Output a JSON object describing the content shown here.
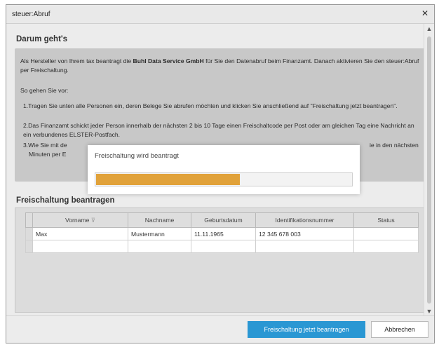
{
  "window": {
    "title": "steuer:Abruf"
  },
  "info": {
    "heading": "Darum geht's",
    "intro_prefix": "Als Hersteller von Ihrem tax beantragt die ",
    "company": "Buhl Data Service GmbH",
    "intro_suffix": " für Sie den Datenabruf beim Finanzamt. Danach aktivieren Sie den steuer:Abruf per Freischaltung.",
    "steps_heading": "So gehen Sie vor:",
    "step1": "1.Tragen Sie unten alle Personen ein, deren Belege Sie abrufen möchten und klicken Sie anschließend auf \"Freischaltung jetzt beantragen\".",
    "step2": "2.Das Finanzamt schickt jeder Person innerhalb der nächsten 2 bis 10 Tage einen Freischaltcode per Post oder am gleichen Tag eine Nachricht an ein verbundenes ELSTER-Postfach.",
    "step3_left": "3.Wie Sie mit de",
    "step3_right": "ie in den nächsten",
    "step3_line2": "Minuten per E"
  },
  "grid": {
    "heading": "Freischaltung beantragen",
    "columns": [
      "Vorname",
      "Nachname",
      "Geburtsdatum",
      "Identifikationsnummer",
      "Status"
    ],
    "rows": [
      [
        "Max",
        "Mustermann",
        "11.11.1965",
        "12 345 678 003",
        ""
      ]
    ]
  },
  "footer": {
    "primary_label": "Freischaltung jetzt beantragen",
    "secondary_label": "Abbrechen"
  },
  "progress_dialog": {
    "label": "Freischaltung wird beantragt",
    "progress": 0.56,
    "color": "#e1a23a"
  }
}
